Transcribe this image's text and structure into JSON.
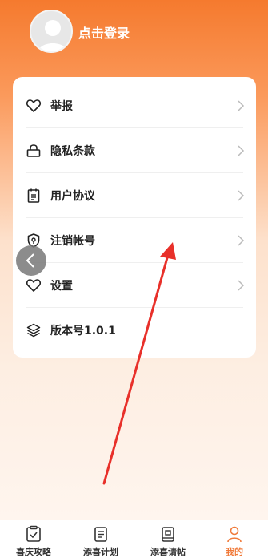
{
  "header": {
    "login_text": "点击登录"
  },
  "menu": {
    "items": [
      {
        "label": "举报",
        "icon": "heart-icon"
      },
      {
        "label": "隐私条款",
        "icon": "lock-icon"
      },
      {
        "label": "用户协议",
        "icon": "document-icon"
      },
      {
        "label": "注销帐号",
        "icon": "shield-icon"
      },
      {
        "label": "设置",
        "icon": "heart-icon"
      },
      {
        "label": "版本号1.0.1",
        "icon": "layers-icon"
      }
    ]
  },
  "tabbar": {
    "tabs": [
      {
        "label": "喜庆攻略",
        "icon": "checklist-icon"
      },
      {
        "label": "添喜计划",
        "icon": "list-icon"
      },
      {
        "label": "添喜请帖",
        "icon": "book-icon"
      },
      {
        "label": "我的",
        "icon": "person-icon",
        "active": true
      }
    ]
  },
  "colors": {
    "accent": "#f07a3a",
    "header_top": "#f57a2e",
    "arrow": "#e8302a"
  }
}
